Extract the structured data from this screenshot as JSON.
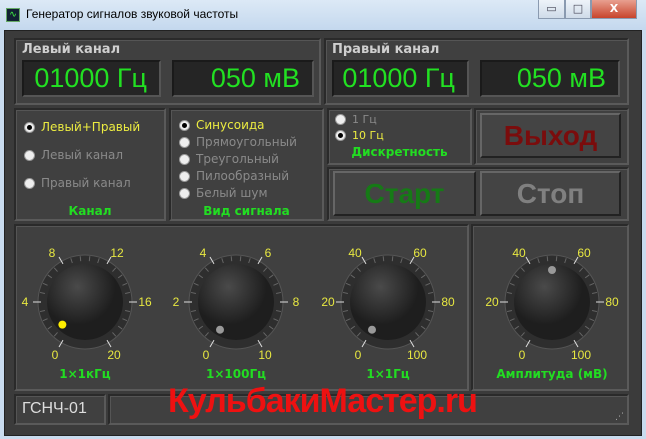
{
  "window": {
    "title": "Генератор сигналов звуковой частоты",
    "minimize": "▭",
    "maximize": "□",
    "close": "X"
  },
  "left_channel": {
    "label": "Левый канал",
    "freq": "01000 Гц",
    "amp": "050 мВ"
  },
  "right_channel": {
    "label": "Правый канал",
    "freq": "01000 Гц",
    "amp": "050 мВ"
  },
  "channel": {
    "caption": "Канал",
    "options": [
      {
        "label": "Левый+Правый",
        "selected": true
      },
      {
        "label": "Левый канал",
        "selected": false
      },
      {
        "label": "Правый канал",
        "selected": false
      }
    ]
  },
  "waveform": {
    "caption": "Вид сигнала",
    "options": [
      {
        "label": "Синусоида",
        "selected": true
      },
      {
        "label": "Прямоугольный",
        "selected": false
      },
      {
        "label": "Треугольный",
        "selected": false
      },
      {
        "label": "Пилообразный",
        "selected": false
      },
      {
        "label": "Белый шум",
        "selected": false
      }
    ]
  },
  "step": {
    "caption": "Дискретность",
    "options": [
      {
        "label": "1 Гц",
        "selected": false
      },
      {
        "label": "10 Гц",
        "selected": true
      }
    ]
  },
  "buttons": {
    "exit": "Выход",
    "start": "Старт",
    "stop": "Стоп"
  },
  "knobs": [
    {
      "caption": "1×1кГц",
      "labels": [
        "0",
        "4",
        "8",
        "12",
        "16",
        "20"
      ],
      "value": 1,
      "max": 20,
      "active": true
    },
    {
      "caption": "1×100Гц",
      "labels": [
        "0",
        "2",
        "4",
        "6",
        "8",
        "10"
      ],
      "value": 0,
      "max": 10,
      "active": false
    },
    {
      "caption": "1×1Гц",
      "labels": [
        "0",
        "20",
        "40",
        "60",
        "80",
        "100"
      ],
      "value": 0,
      "max": 100,
      "active": false
    },
    {
      "caption": "Амплитуда (мВ)",
      "labels": [
        "0",
        "20",
        "40",
        "60",
        "80",
        "100"
      ],
      "value": 50,
      "max": 100,
      "active": false
    }
  ],
  "status": {
    "device": "ГСНЧ-01",
    "watermark": "КульбакиМастер.ru"
  }
}
